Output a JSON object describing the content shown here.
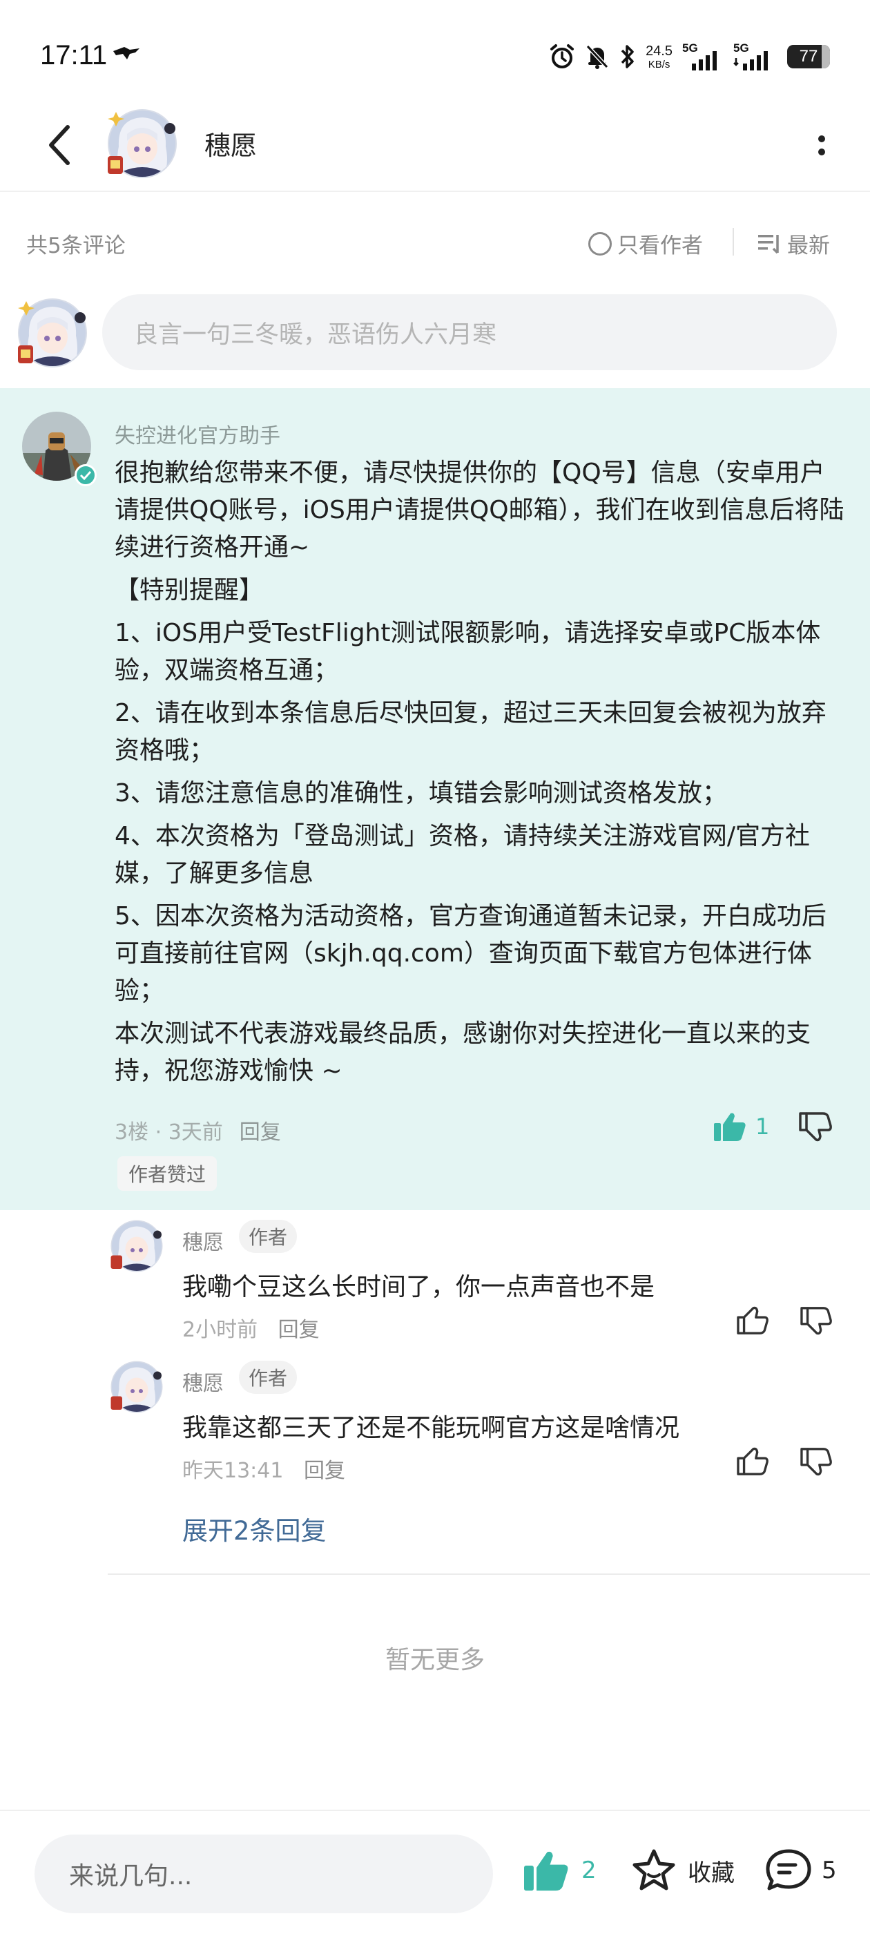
{
  "status_bar": {
    "time": "17:11",
    "net_speed_value": "24.5",
    "net_speed_unit": "KB/s",
    "signal1_label": "5G",
    "signal2_label": "5G",
    "battery_level": "77"
  },
  "header": {
    "title": "穗愿"
  },
  "filter_bar": {
    "count_label": "共5条评论",
    "only_author_label": "只看作者",
    "sort_label": "最新"
  },
  "compose": {
    "placeholder": "良言一句三冬暖，恶语伤人六月寒"
  },
  "main_comment": {
    "author": "失控进化官方助手",
    "paragraphs": [
      "很抱歉给您带来不便，请尽快提供你的【QQ号】信息（安卓用户请提供QQ账号，iOS用户请提供QQ邮箱），我们在收到信息后将陆续进行资格开通~",
      "【特别提醒】",
      "1、iOS用户受TestFlight测试限额影响，请选择安卓或PC版本体验，双端资格互通；",
      "2、请在收到本条信息后尽快回复，超过三天未回复会被视为放弃资格哦；",
      "3、请您注意信息的准确性，填错会影响测试资格发放；",
      "4、本次资格为「登岛测试」资格，请持续关注游戏官网/官方社媒，了解更多信息",
      "5、因本次资格为活动资格，官方查询通道暂未记录，开白成功后可直接前往官网（skjh.qq.com）查询页面下载官方包体进行体验；",
      "本次测试不代表游戏最终品质，感谢你对失控进化一直以来的支持，祝您游戏愉快 ~"
    ],
    "floor_time": "3楼 · 3天前",
    "reply_label": "回复",
    "like_count": "1",
    "author_liked_badge": "作者赞过"
  },
  "replies": [
    {
      "author": "穗愿",
      "tag": "作者",
      "text": "我嘞个豆这么长时间了，你一点声音也不是",
      "time": "2小时前",
      "reply_label": "回复"
    },
    {
      "author": "穗愿",
      "tag": "作者",
      "text": "我靠这都三天了还是不能玩啊官方这是啥情况",
      "time": "昨天13:41",
      "reply_label": "回复"
    }
  ],
  "expand_label": "展开2条回复",
  "no_more_label": "暂无更多",
  "bottom_bar": {
    "input_placeholder": "来说几句...",
    "like_count": "2",
    "favorite_label": "收藏",
    "comment_count": "5"
  },
  "colors": {
    "accent": "#3bb8a8",
    "highlight_bg": "#e4f5f3",
    "link": "#416a96"
  }
}
